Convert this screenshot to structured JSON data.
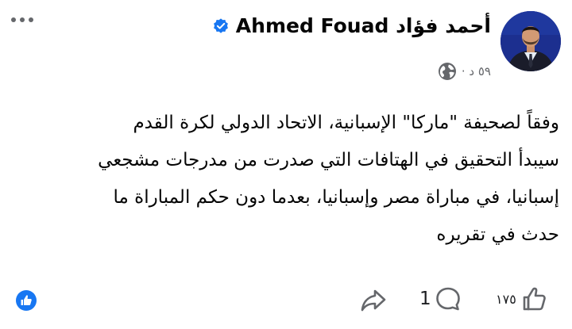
{
  "author": {
    "name": "Ahmed Fouad أحمد فؤاد",
    "verified": true
  },
  "meta": {
    "time": "٥٩ د ·",
    "audience_icon": "globe-icon"
  },
  "post": {
    "lines": [
      "وفقاً لصحيفة \"ماركا\" الإسبانية، الاتحاد الدولي لكرة القدم",
      "سيبدأ التحقيق في الهتافات التي صدرت من مدرجات مشجعي",
      "إسبانيا، في مباراة مصر وإسبانيا، بعدما دون  حكم المباراة ما",
      "حدث في تقريره"
    ]
  },
  "footer": {
    "like_count": "١٧٥",
    "comment_count": "1",
    "reaction_icon": "like-reaction-icon"
  },
  "colors": {
    "verified": "#1877f2",
    "reaction": "#1877f2",
    "muted": "#65676b",
    "icon": "#65676b"
  }
}
